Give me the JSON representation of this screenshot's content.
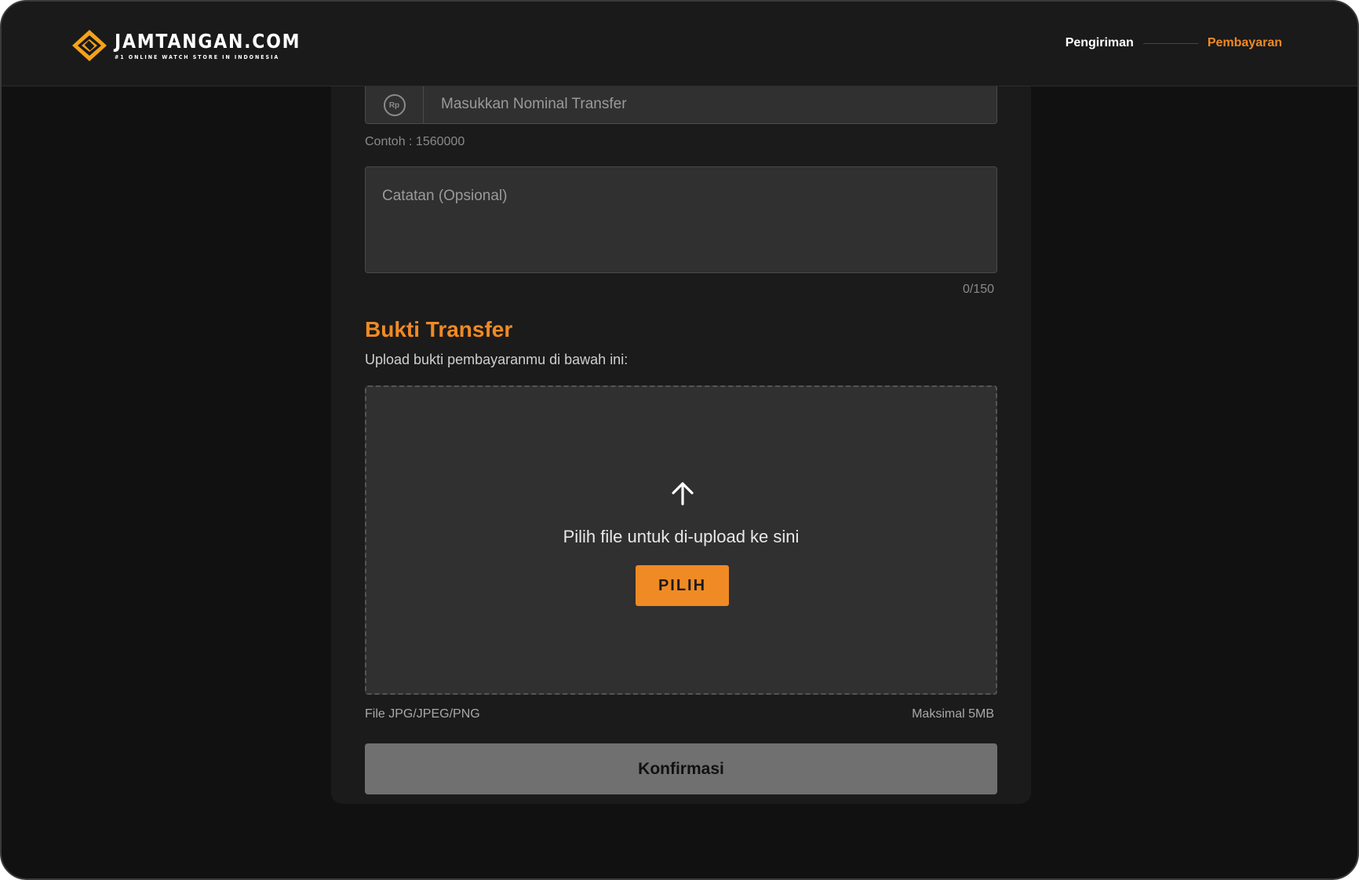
{
  "header": {
    "logo_title": "JAMTANGAN.COM",
    "logo_tagline": "#1 ONLINE WATCH STORE IN INDONESIA",
    "steps": [
      {
        "label": "Pengiriman",
        "state": "done"
      },
      {
        "label": "Pembayaran",
        "state": "active"
      }
    ]
  },
  "form": {
    "nominal": {
      "icon": "rupiah-coin-icon",
      "icon_text": "Rp",
      "placeholder": "Masukkan Nominal Transfer",
      "value": "",
      "hint": "Contoh : 1560000"
    },
    "notes": {
      "placeholder": "Catatan (Opsional)",
      "value": "",
      "counter": "0/150"
    }
  },
  "upload": {
    "title": "Bukti Transfer",
    "subtitle": "Upload bukti pembayaranmu di bawah ini:",
    "icon": "arrow-up-icon",
    "drop_text": "Pilih file untuk di-upload ke sini",
    "pick_label": "PILIH",
    "file_types": "File JPG/JPEG/PNG",
    "max_size": "Maksimal 5MB"
  },
  "confirm_label": "Konfirmasi",
  "colors": {
    "accent": "#f08a24",
    "background": "#111111",
    "card": "#1b1b1b",
    "input": "#303030",
    "disabled_button": "#707070"
  }
}
